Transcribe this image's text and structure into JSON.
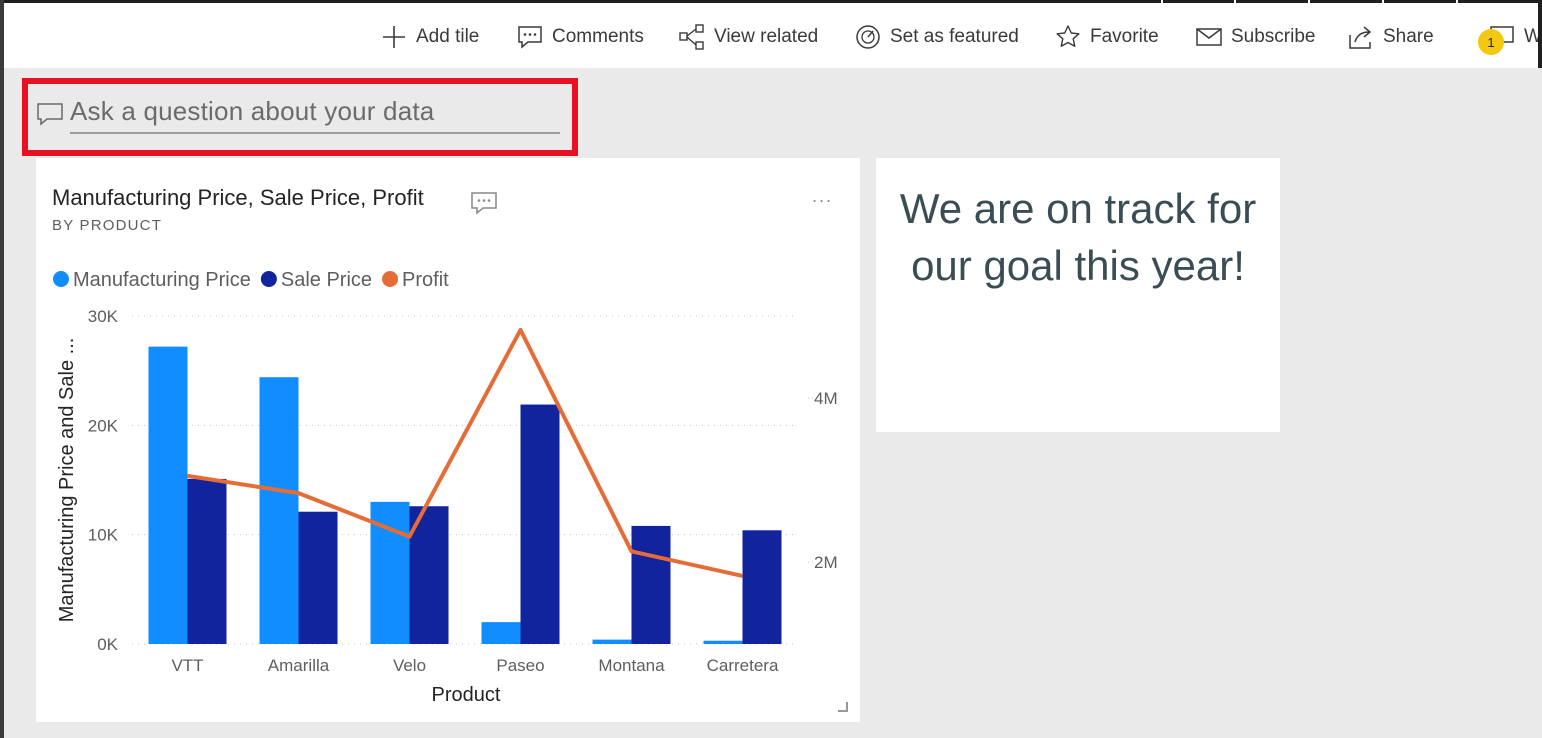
{
  "toolbar": {
    "add_tile": "Add tile",
    "comments": "Comments",
    "view_related": "View related",
    "set_as_featured": "Set as featured",
    "favorite": "Favorite",
    "subscribe": "Subscribe",
    "share": "Share",
    "notification_count": "1",
    "truncated_item": "W"
  },
  "qa": {
    "placeholder": "Ask a question about your data"
  },
  "chart_tile": {
    "title": "Manufacturing Price, Sale Price, Profit",
    "subtitle": "BY PRODUCT",
    "more": "..."
  },
  "text_tile": {
    "line1": "We are on track for",
    "line2": "our goal this year!"
  },
  "colors": {
    "manufacturing_price": "#118dff",
    "sale_price": "#12239e",
    "profit": "#e66c37",
    "qa_highlight": "#e81123",
    "notification": "#f2c811"
  },
  "chart_data": {
    "type": "bar",
    "categories": [
      "VTT",
      "Amarilla",
      "Velo",
      "Paseo",
      "Montana",
      "Carretera"
    ],
    "series": [
      {
        "name": "Manufacturing Price",
        "kind": "bar",
        "axis": "left",
        "values": [
          27200,
          24400,
          13000,
          2000,
          400,
          300
        ]
      },
      {
        "name": "Sale Price",
        "kind": "bar",
        "axis": "left",
        "values": [
          15100,
          12100,
          12600,
          21900,
          10800,
          10400
        ]
      },
      {
        "name": "Profit",
        "kind": "line",
        "axis": "right",
        "values": [
          3050000,
          2840000,
          2310000,
          4830000,
          2130000,
          1830000
        ]
      }
    ],
    "xlabel": "Product",
    "ylabel": "Manufacturing Price and Sale ...",
    "left_ticks": [
      "0K",
      "10K",
      "20K",
      "30K"
    ],
    "right_ticks": [
      "2M",
      "4M"
    ],
    "ylim_left": [
      0,
      30000
    ],
    "legend": [
      "Manufacturing Price",
      "Sale Price",
      "Profit"
    ],
    "legend_position": "top-left",
    "grid": true
  }
}
